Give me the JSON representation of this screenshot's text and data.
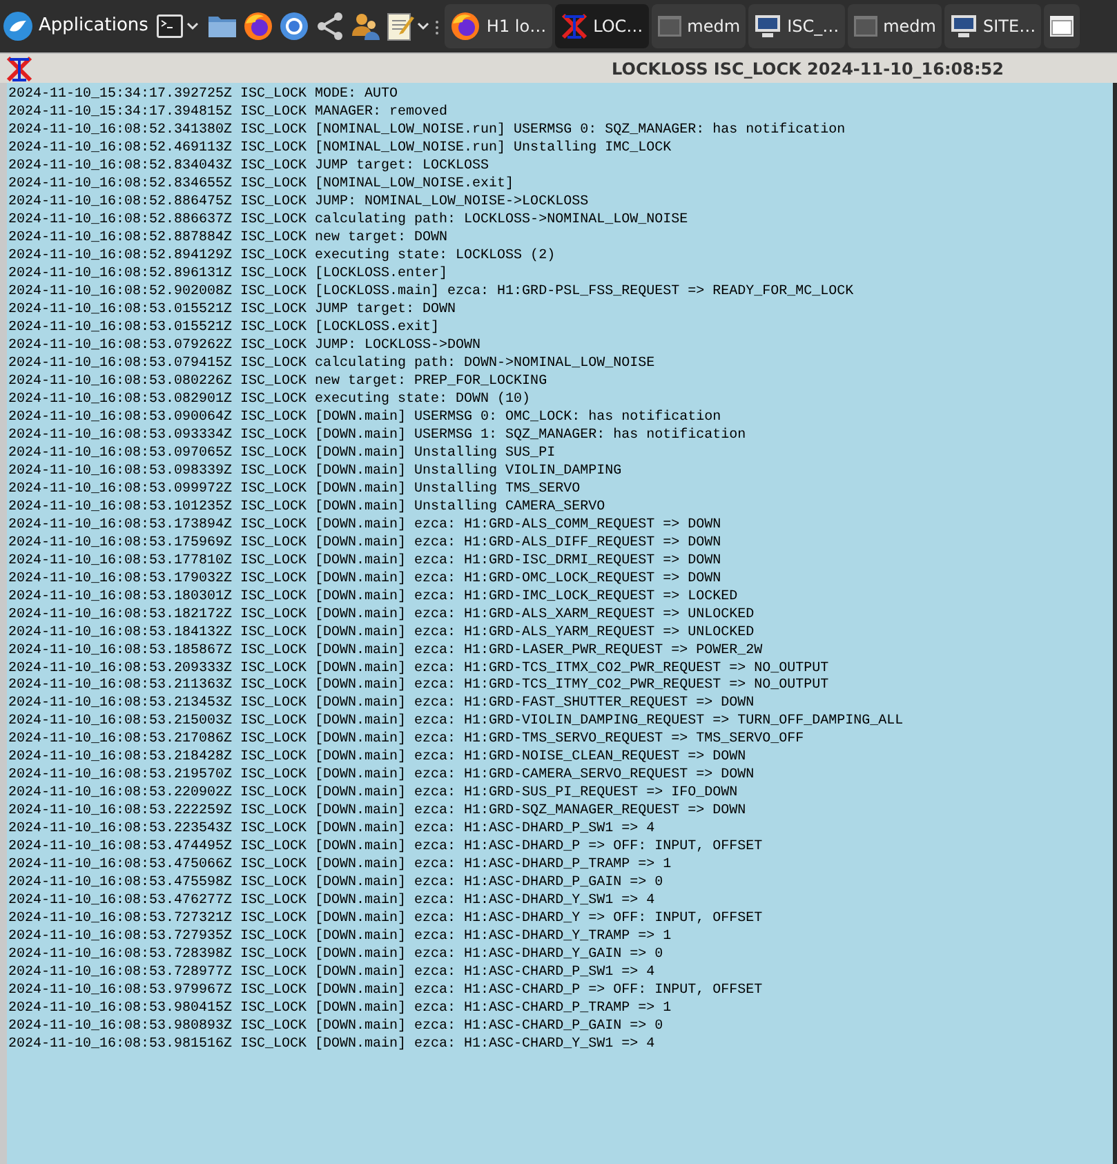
{
  "taskbar": {
    "menu_label": "Applications",
    "tasks": [
      {
        "kind": "firefox",
        "label": "H1 lo…",
        "selected": false
      },
      {
        "kind": "guardian",
        "label": "LOC…",
        "selected": true
      },
      {
        "kind": "window",
        "label": "medm",
        "selected": false
      },
      {
        "kind": "monitor",
        "label": "ISC_…",
        "selected": false
      },
      {
        "kind": "window",
        "label": "medm",
        "selected": false
      },
      {
        "kind": "monitor",
        "label": "SITE…",
        "selected": false
      },
      {
        "kind": "blank",
        "selected": false
      }
    ]
  },
  "window": {
    "title": "LOCKLOSS ISC_LOCK 2024-11-10_16:08:52"
  },
  "log": [
    "2024-11-10_15:34:17.392725Z ISC_LOCK MODE: AUTO",
    "2024-11-10_15:34:17.394815Z ISC_LOCK MANAGER: removed",
    "2024-11-10_16:08:52.341380Z ISC_LOCK [NOMINAL_LOW_NOISE.run] USERMSG 0: SQZ_MANAGER: has notification",
    "2024-11-10_16:08:52.469113Z ISC_LOCK [NOMINAL_LOW_NOISE.run] Unstalling IMC_LOCK",
    "2024-11-10_16:08:52.834043Z ISC_LOCK JUMP target: LOCKLOSS",
    "2024-11-10_16:08:52.834655Z ISC_LOCK [NOMINAL_LOW_NOISE.exit]",
    "2024-11-10_16:08:52.886475Z ISC_LOCK JUMP: NOMINAL_LOW_NOISE->LOCKLOSS",
    "2024-11-10_16:08:52.886637Z ISC_LOCK calculating path: LOCKLOSS->NOMINAL_LOW_NOISE",
    "2024-11-10_16:08:52.887884Z ISC_LOCK new target: DOWN",
    "2024-11-10_16:08:52.894129Z ISC_LOCK executing state: LOCKLOSS (2)",
    "2024-11-10_16:08:52.896131Z ISC_LOCK [LOCKLOSS.enter]",
    "2024-11-10_16:08:52.902008Z ISC_LOCK [LOCKLOSS.main] ezca: H1:GRD-PSL_FSS_REQUEST => READY_FOR_MC_LOCK",
    "2024-11-10_16:08:53.015521Z ISC_LOCK JUMP target: DOWN",
    "2024-11-10_16:08:53.015521Z ISC_LOCK [LOCKLOSS.exit]",
    "2024-11-10_16:08:53.079262Z ISC_LOCK JUMP: LOCKLOSS->DOWN",
    "2024-11-10_16:08:53.079415Z ISC_LOCK calculating path: DOWN->NOMINAL_LOW_NOISE",
    "2024-11-10_16:08:53.080226Z ISC_LOCK new target: PREP_FOR_LOCKING",
    "2024-11-10_16:08:53.082901Z ISC_LOCK executing state: DOWN (10)",
    "2024-11-10_16:08:53.090064Z ISC_LOCK [DOWN.main] USERMSG 0: OMC_LOCK: has notification",
    "2024-11-10_16:08:53.093334Z ISC_LOCK [DOWN.main] USERMSG 1: SQZ_MANAGER: has notification",
    "2024-11-10_16:08:53.097065Z ISC_LOCK [DOWN.main] Unstalling SUS_PI",
    "2024-11-10_16:08:53.098339Z ISC_LOCK [DOWN.main] Unstalling VIOLIN_DAMPING",
    "2024-11-10_16:08:53.099972Z ISC_LOCK [DOWN.main] Unstalling TMS_SERVO",
    "2024-11-10_16:08:53.101235Z ISC_LOCK [DOWN.main] Unstalling CAMERA_SERVO",
    "2024-11-10_16:08:53.173894Z ISC_LOCK [DOWN.main] ezca: H1:GRD-ALS_COMM_REQUEST => DOWN",
    "2024-11-10_16:08:53.175969Z ISC_LOCK [DOWN.main] ezca: H1:GRD-ALS_DIFF_REQUEST => DOWN",
    "2024-11-10_16:08:53.177810Z ISC_LOCK [DOWN.main] ezca: H1:GRD-ISC_DRMI_REQUEST => DOWN",
    "2024-11-10_16:08:53.179032Z ISC_LOCK [DOWN.main] ezca: H1:GRD-OMC_LOCK_REQUEST => DOWN",
    "2024-11-10_16:08:53.180301Z ISC_LOCK [DOWN.main] ezca: H1:GRD-IMC_LOCK_REQUEST => LOCKED",
    "2024-11-10_16:08:53.182172Z ISC_LOCK [DOWN.main] ezca: H1:GRD-ALS_XARM_REQUEST => UNLOCKED",
    "2024-11-10_16:08:53.184132Z ISC_LOCK [DOWN.main] ezca: H1:GRD-ALS_YARM_REQUEST => UNLOCKED",
    "2024-11-10_16:08:53.185867Z ISC_LOCK [DOWN.main] ezca: H1:GRD-LASER_PWR_REQUEST => POWER_2W",
    "2024-11-10_16:08:53.209333Z ISC_LOCK [DOWN.main] ezca: H1:GRD-TCS_ITMX_CO2_PWR_REQUEST => NO_OUTPUT",
    "2024-11-10_16:08:53.211363Z ISC_LOCK [DOWN.main] ezca: H1:GRD-TCS_ITMY_CO2_PWR_REQUEST => NO_OUTPUT",
    "2024-11-10_16:08:53.213453Z ISC_LOCK [DOWN.main] ezca: H1:GRD-FAST_SHUTTER_REQUEST => DOWN",
    "2024-11-10_16:08:53.215003Z ISC_LOCK [DOWN.main] ezca: H1:GRD-VIOLIN_DAMPING_REQUEST => TURN_OFF_DAMPING_ALL",
    "2024-11-10_16:08:53.217086Z ISC_LOCK [DOWN.main] ezca: H1:GRD-TMS_SERVO_REQUEST => TMS_SERVO_OFF",
    "2024-11-10_16:08:53.218428Z ISC_LOCK [DOWN.main] ezca: H1:GRD-NOISE_CLEAN_REQUEST => DOWN",
    "2024-11-10_16:08:53.219570Z ISC_LOCK [DOWN.main] ezca: H1:GRD-CAMERA_SERVO_REQUEST => DOWN",
    "2024-11-10_16:08:53.220902Z ISC_LOCK [DOWN.main] ezca: H1:GRD-SUS_PI_REQUEST => IFO_DOWN",
    "2024-11-10_16:08:53.222259Z ISC_LOCK [DOWN.main] ezca: H1:GRD-SQZ_MANAGER_REQUEST => DOWN",
    "2024-11-10_16:08:53.223543Z ISC_LOCK [DOWN.main] ezca: H1:ASC-DHARD_P_SW1 => 4",
    "2024-11-10_16:08:53.474495Z ISC_LOCK [DOWN.main] ezca: H1:ASC-DHARD_P => OFF: INPUT, OFFSET",
    "2024-11-10_16:08:53.475066Z ISC_LOCK [DOWN.main] ezca: H1:ASC-DHARD_P_TRAMP => 1",
    "2024-11-10_16:08:53.475598Z ISC_LOCK [DOWN.main] ezca: H1:ASC-DHARD_P_GAIN => 0",
    "2024-11-10_16:08:53.476277Z ISC_LOCK [DOWN.main] ezca: H1:ASC-DHARD_Y_SW1 => 4",
    "2024-11-10_16:08:53.727321Z ISC_LOCK [DOWN.main] ezca: H1:ASC-DHARD_Y => OFF: INPUT, OFFSET",
    "2024-11-10_16:08:53.727935Z ISC_LOCK [DOWN.main] ezca: H1:ASC-DHARD_Y_TRAMP => 1",
    "2024-11-10_16:08:53.728398Z ISC_LOCK [DOWN.main] ezca: H1:ASC-DHARD_Y_GAIN => 0",
    "2024-11-10_16:08:53.728977Z ISC_LOCK [DOWN.main] ezca: H1:ASC-CHARD_P_SW1 => 4",
    "2024-11-10_16:08:53.979967Z ISC_LOCK [DOWN.main] ezca: H1:ASC-CHARD_P => OFF: INPUT, OFFSET",
    "2024-11-10_16:08:53.980415Z ISC_LOCK [DOWN.main] ezca: H1:ASC-CHARD_P_TRAMP => 1",
    "2024-11-10_16:08:53.980893Z ISC_LOCK [DOWN.main] ezca: H1:ASC-CHARD_P_GAIN => 0",
    "2024-11-10_16:08:53.981516Z ISC_LOCK [DOWN.main] ezca: H1:ASC-CHARD_Y_SW1 => 4"
  ]
}
